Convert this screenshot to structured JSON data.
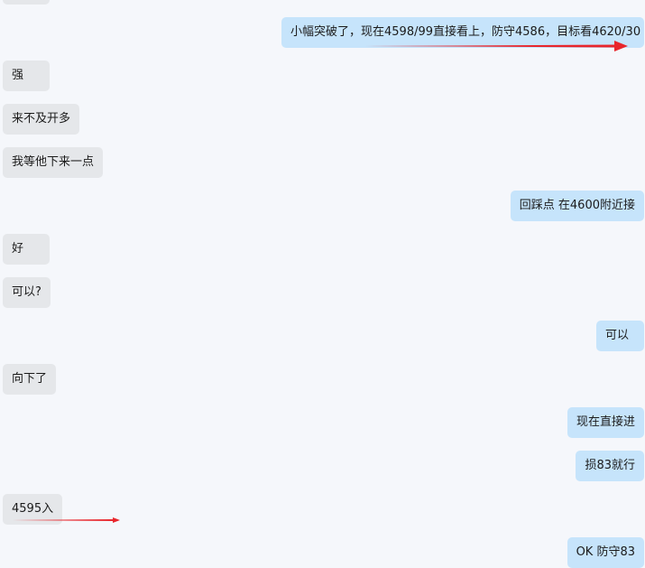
{
  "chat": {
    "messages": [
      {
        "side": "left",
        "text": ""
      },
      {
        "side": "right",
        "text": "小幅突破了，现在4598/99直接看上，防守4586，目标看4620/30"
      },
      {
        "side": "left",
        "text": "强"
      },
      {
        "side": "left",
        "text": "来不及开多"
      },
      {
        "side": "left",
        "text": "我等他下来一点"
      },
      {
        "side": "right",
        "text": "回踩点 在4600附近接"
      },
      {
        "side": "left",
        "text": "好"
      },
      {
        "side": "left",
        "text": "可以?"
      },
      {
        "side": "right",
        "text": "可以"
      },
      {
        "side": "left",
        "text": "向下了"
      },
      {
        "side": "right",
        "text": "现在直接进"
      },
      {
        "side": "right",
        "text": "损83就行"
      },
      {
        "side": "left",
        "text": "4595入"
      },
      {
        "side": "right",
        "text": "OK 防守83"
      }
    ]
  },
  "colors": {
    "background": "#f5f7fb",
    "incoming_bubble": "#e5e7ea",
    "outgoing_bubble": "#c6e4fb",
    "annotation_arrow": "#e8262c"
  }
}
